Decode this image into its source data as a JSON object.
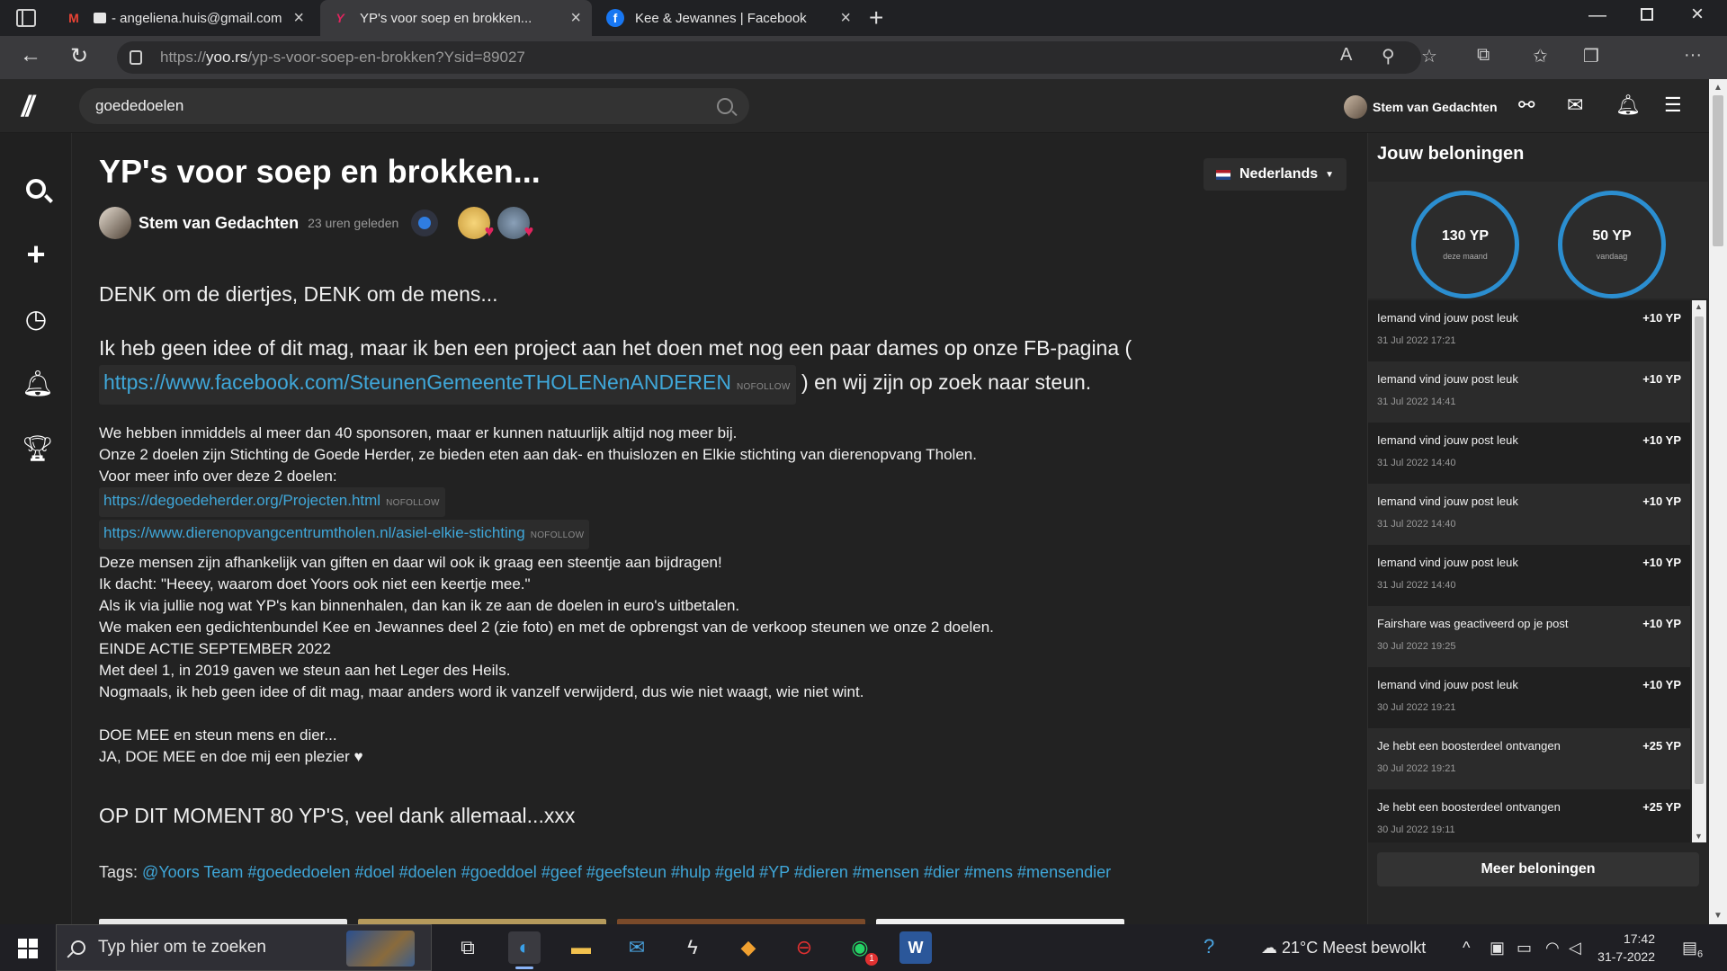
{
  "browser": {
    "tabs": [
      {
        "label": "- angeliena.huis@gmail.com",
        "favicon": "M"
      },
      {
        "label": "YP's voor soep en brokken...",
        "favicon": "Y",
        "active": true
      },
      {
        "label": "Kee & Jewannes | Facebook",
        "favicon": "f"
      }
    ],
    "url_prefix": "https://",
    "url_host": "yoo.rs",
    "url_path": "/yp-s-voor-soep-en-brokken?Ysid=89027"
  },
  "header": {
    "search_value": "goededoelen",
    "username": "Stem van Gedachten"
  },
  "post": {
    "title": "YP's voor soep en brokken...",
    "language": "Nederlands",
    "author": "Stem van Gedachten",
    "time": "23 uren geleden",
    "lead1": "DENK om de diertjes, DENK om de mens...",
    "lead2a": "Ik heb geen idee of dit mag, maar ik ben een project aan het doen met nog een paar dames op onze FB-pagina (",
    "lead2_link": "https://www.facebook.com/SteunenGemeenteTHOLENenANDEREN",
    "lead2b": ") en wij zijn op zoek naar steun.",
    "nofollow": "NOFOLLOW",
    "para1": [
      "We hebben inmiddels al meer dan 40 sponsoren, maar er kunnen natuurlijk altijd nog meer bij.",
      "Onze 2 doelen zijn Stichting de Goede Herder, ze bieden eten aan dak- en thuislozen en Elkie stichting van dierenopvang Tholen.",
      "Voor meer info over deze 2 doelen:"
    ],
    "link1": "https://degoedeherder.org/Projecten.html",
    "link2": "https://www.dierenopvangcentrumtholen.nl/asiel-elkie-stichting",
    "para2": [
      "Deze mensen zijn afhankelijk van giften en daar wil ook ik graag een steentje aan bijdragen!",
      "Ik dacht: \"Heeey, waarom doet Yoors ook niet een keertje mee.\"",
      "Als ik via jullie nog wat YP's kan binnenhalen, dan kan ik ze aan de doelen in euro's uitbetalen.",
      "We maken een gedichtenbundel Kee en Jewannes deel 2 (zie foto) en met de opbrengst van de verkoop steunen we onze 2 doelen.",
      "EINDE ACTIE SEPTEMBER 2022",
      "Met deel 1, in 2019 gaven we steun aan het Leger des Heils.",
      "Nogmaals, ik heb geen idee of dit mag, maar anders word ik vanzelf verwijderd, dus wie niet waagt, wie niet wint."
    ],
    "para3": [
      "DOE MEE en steun mens en dier...",
      "JA, DOE MEE en doe mij een plezier ♥"
    ],
    "closing": "OP DIT MOMENT  80 YP'S, veel dank allemaal...xxx",
    "tags_label": "Tags:",
    "tags": [
      "@Yoors Team",
      "#goededoelen",
      "#doel",
      "#doelen",
      "#goeddoel",
      "#geef",
      "#geefsteun",
      "#hulp",
      "#geld",
      "#YP",
      "#dieren",
      "#mensen",
      "#dier",
      "#mens",
      "#mensendier"
    ]
  },
  "rewards": {
    "title": "Jouw beloningen",
    "month_value": "130 YP",
    "month_label": "deze maand",
    "today_value": "50 YP",
    "today_label": "vandaag",
    "items": [
      {
        "text": "Iemand vind jouw post leuk",
        "date": "31 Jul 2022 17:21",
        "points": "+10 YP"
      },
      {
        "text": "Iemand vind jouw post leuk",
        "date": "31 Jul 2022 14:41",
        "points": "+10 YP"
      },
      {
        "text": "Iemand vind jouw post leuk",
        "date": "31 Jul 2022 14:40",
        "points": "+10 YP"
      },
      {
        "text": "Iemand vind jouw post leuk",
        "date": "31 Jul 2022 14:40",
        "points": "+10 YP"
      },
      {
        "text": "Iemand vind jouw post leuk",
        "date": "31 Jul 2022 14:40",
        "points": "+10 YP"
      },
      {
        "text": "Fairshare was geactiveerd op je post",
        "date": "30 Jul 2022 19:25",
        "points": "+10 YP"
      },
      {
        "text": "Iemand vind jouw post leuk",
        "date": "30 Jul 2022 19:21",
        "points": "+10 YP"
      },
      {
        "text": "Je hebt een boosterdeel ontvangen",
        "date": "30 Jul 2022 19:21",
        "points": "+25 YP"
      },
      {
        "text": "Je hebt een boosterdeel ontvangen",
        "date": "30 Jul 2022 19:11",
        "points": "+25 YP"
      }
    ],
    "more_label": "Meer beloningen"
  },
  "taskbar": {
    "search_placeholder": "Typ hier om te zoeken",
    "weather": "21°C  Meest bewolkt",
    "time": "17:42",
    "date": "31-7-2022",
    "notification_count": "6",
    "whatsapp_badge": "1"
  },
  "colors": {
    "link": "#3fa7d9",
    "ring": "#2b8ed0",
    "background": "#222222"
  }
}
